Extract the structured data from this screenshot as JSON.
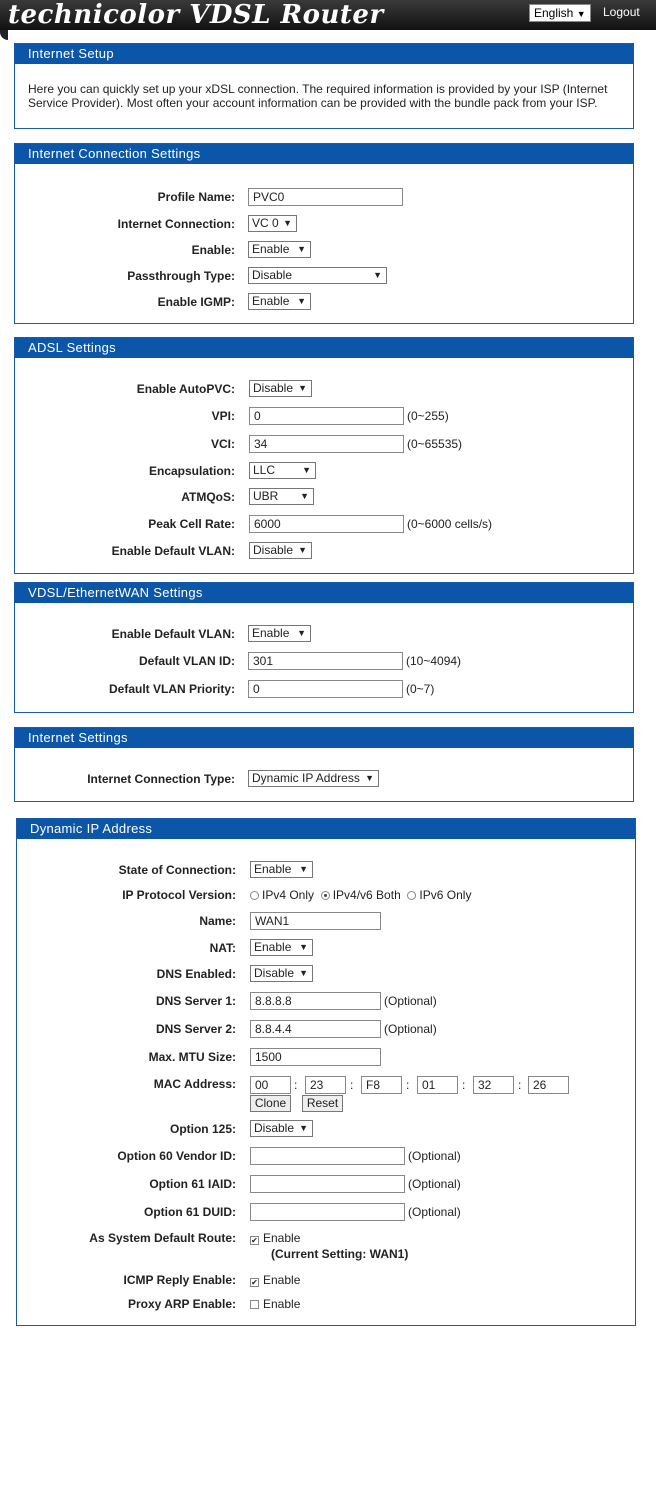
{
  "header": {
    "logo": "technicolor VDSL Router",
    "language": "English",
    "logout": "Logout"
  },
  "internet_setup": {
    "title": "Internet Setup",
    "text": "Here you can quickly set up your xDSL connection. The required information is provided by your ISP (Internet Service Provider). Most often your account information can be provided with the bundle pack from your ISP."
  },
  "conn": {
    "title": "Internet Connection Settings",
    "profile_label": "Profile Name:",
    "profile_value": "PVC0",
    "internet_label": "Internet Connection:",
    "internet_value": "VC 0",
    "enable_label": "Enable:",
    "enable_value": "Enable",
    "pass_label": "Passthrough Type:",
    "pass_value": "Disable",
    "igmp_label": "Enable IGMP:",
    "igmp_value": "Enable"
  },
  "adsl": {
    "title": "ADSL Settings",
    "autopvc_label": "Enable AutoPVC:",
    "autopvc_value": "Disable",
    "vpi_label": "VPI:",
    "vpi_value": "0",
    "vpi_hint": "(0~255)",
    "vci_label": "VCI:",
    "vci_value": "34",
    "vci_hint": "(0~65535)",
    "encap_label": "Encapsulation:",
    "encap_value": "LLC",
    "atm_label": "ATMQoS:",
    "atm_value": "UBR",
    "pcr_label": "Peak Cell Rate:",
    "pcr_value": "6000",
    "pcr_hint": "(0~6000 cells/s)",
    "vlan_label": "Enable Default VLAN:",
    "vlan_value": "Disable"
  },
  "vdsl": {
    "title": "VDSL/EthernetWAN Settings",
    "vlan_label": "Enable Default VLAN:",
    "vlan_value": "Enable",
    "vid_label": "Default VLAN ID:",
    "vid_value": "301",
    "vid_hint": "(10~4094)",
    "prio_label": "Default VLAN Priority:",
    "prio_value": "0",
    "prio_hint": "(0~7)"
  },
  "isettings": {
    "title": "Internet Settings",
    "type_label": "Internet Connection Type:",
    "type_value": "Dynamic IP Address"
  },
  "dyn": {
    "title": "Dynamic IP Address",
    "state_label": "State of Connection:",
    "state_value": "Enable",
    "ipv_label": "IP Protocol Version:",
    "ipv4": "IPv4 Only",
    "ipv46": "IPv4/v6 Both",
    "ipv6": "IPv6 Only",
    "name_label": "Name:",
    "name_value": "WAN1",
    "nat_label": "NAT:",
    "nat_value": "Enable",
    "dns_label": "DNS Enabled:",
    "dns_value": "Disable",
    "dns1_label": "DNS Server 1:",
    "dns1_value": "8.8.8.8",
    "dns1_hint": "(Optional)",
    "dns2_label": "DNS Server 2:",
    "dns2_value": "8.8.4.4",
    "dns2_hint": "(Optional)",
    "mtu_label": "Max. MTU Size:",
    "mtu_value": "1500",
    "mac_label": "MAC Address:",
    "mac": [
      "00",
      "23",
      "F8",
      "01",
      "32",
      "26"
    ],
    "clone": "Clone",
    "reset": "Reset",
    "o125_label": "Option 125:",
    "o125_value": "Disable",
    "o60_label": "Option 60 Vendor ID:",
    "o60_hint": "(Optional)",
    "o61i_label": "Option 61 IAID:",
    "o61i_hint": "(Optional)",
    "o61d_label": "Option 61 DUID:",
    "o61d_hint": "(Optional)",
    "route_label": "As System Default Route:",
    "route_enable": "Enable",
    "route_current": "(Current Setting: WAN1)",
    "icmp_label": "ICMP Reply Enable:",
    "icmp_enable": "Enable",
    "arp_label": "Proxy ARP Enable:",
    "arp_enable": "Enable"
  }
}
